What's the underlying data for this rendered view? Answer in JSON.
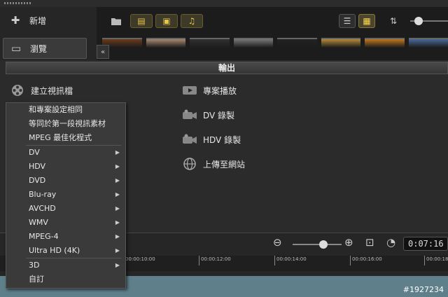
{
  "nav": {
    "add_label": "新增",
    "browse_label": "瀏覽",
    "collapse_glyph": "«"
  },
  "library": {
    "thumbnails": [
      "#6b3a1a",
      "#a88a70",
      "#303030",
      "#777",
      "#222",
      "#b58a3a",
      "#c07820",
      "#4a6a9a"
    ]
  },
  "section": {
    "title": "輸出"
  },
  "output_options": {
    "create_video": "建立視訊檔",
    "project_playback": "專案播放",
    "dv_record": "DV 錄製",
    "hdv_record": "HDV 錄製",
    "upload_web": "上傳至網站"
  },
  "menu": {
    "items": [
      {
        "label": "和專案設定相同",
        "submenu": false
      },
      {
        "label": "等同於第一段視訊素材",
        "submenu": false
      },
      {
        "label": "MPEG 最佳化程式",
        "submenu": false
      },
      {
        "label": "DV",
        "submenu": true
      },
      {
        "label": "HDV",
        "submenu": true
      },
      {
        "label": "DVD",
        "submenu": true
      },
      {
        "label": "Blu-ray",
        "submenu": true
      },
      {
        "label": "AVCHD",
        "submenu": true
      },
      {
        "label": "WMV",
        "submenu": true
      },
      {
        "label": "MPEG-4",
        "submenu": true
      },
      {
        "label": "Ultra HD (4K)",
        "submenu": true
      },
      {
        "label": "3D",
        "submenu": true
      },
      {
        "label": "自訂",
        "submenu": false
      }
    ]
  },
  "timeline": {
    "timecode": "0:07:16",
    "ticks": [
      "00:00:10:00",
      "00:00:12:00",
      "00:00:14:00",
      "00:00:16:00",
      "00:00:18:"
    ]
  },
  "watermark": "#1927234"
}
